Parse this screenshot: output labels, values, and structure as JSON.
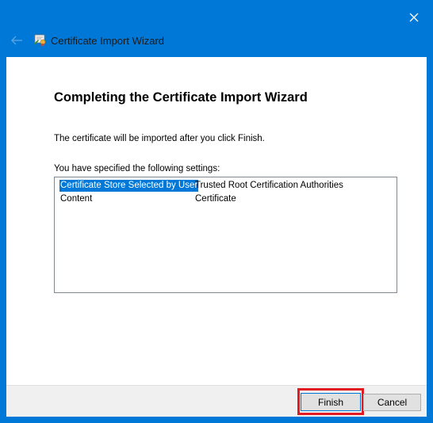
{
  "window": {
    "title": "Certificate Import Wizard",
    "accent_color": "#0078d7"
  },
  "icons": {
    "close": "close-icon",
    "back": "back-arrow-icon",
    "wizard": "certificate-wizard-icon"
  },
  "main": {
    "heading": "Completing the Certificate Import Wizard",
    "description": "The certificate will be imported after you click Finish.",
    "settings_label": "You have specified the following settings:",
    "settings": [
      {
        "key": "Certificate Store Selected by User",
        "value": "Trusted Root Certification Authorities",
        "selected": true
      },
      {
        "key": "Content",
        "value": "Certificate",
        "selected": false
      }
    ]
  },
  "footer": {
    "finish_label": "Finish",
    "cancel_label": "Cancel",
    "highlight_color": "#e21b23"
  }
}
